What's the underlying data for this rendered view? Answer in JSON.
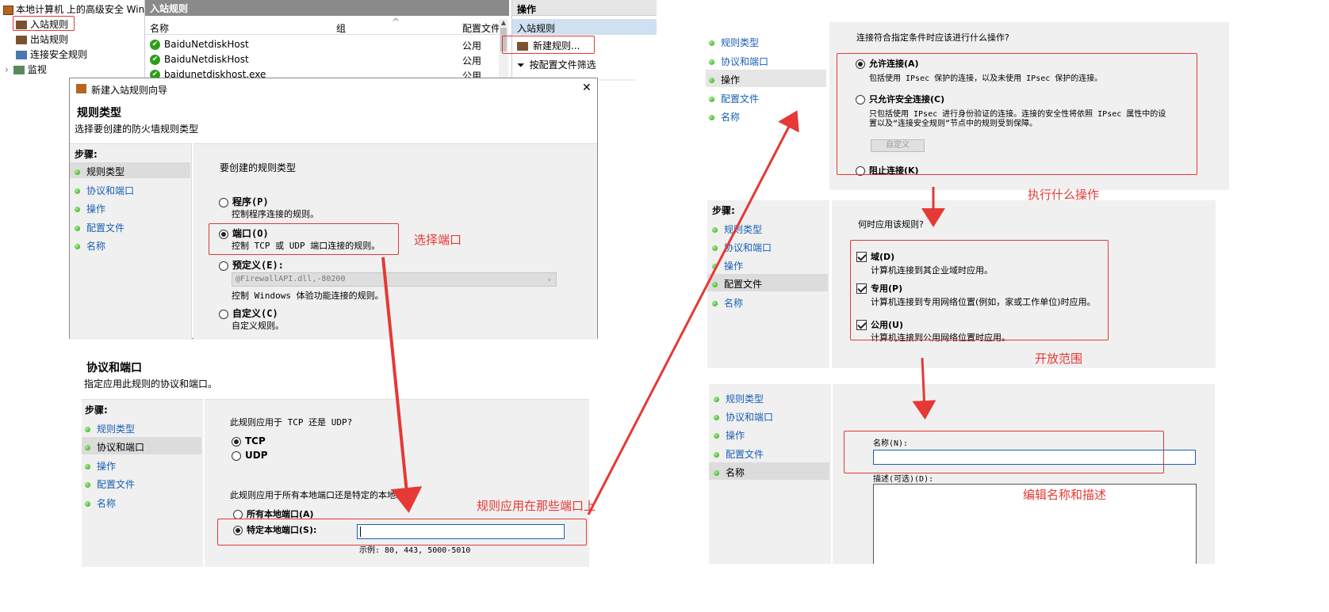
{
  "tree": {
    "root": "本地计算机 上的高级安全 Wind",
    "inbound": "入站规则",
    "outbound": "出站规则",
    "connsec": "连接安全规则",
    "monitor": "监视"
  },
  "list": {
    "header": "入站规则",
    "col_name": "名称",
    "col_group": "组",
    "col_profile": "配置文件",
    "rows": [
      {
        "name": "BaiduNetdiskHost",
        "profile": "公用"
      },
      {
        "name": "BaiduNetdiskHost",
        "profile": "公用"
      },
      {
        "name": "baidunetdiskhost.exe",
        "profile": "公用"
      }
    ]
  },
  "actions": {
    "header": "操作",
    "sub": "入站规则",
    "new_rule": "新建规则...",
    "filter": "按配置文件筛选"
  },
  "wizard": {
    "title": "新建入站规则向导",
    "close": "✕",
    "heading": "规则类型",
    "subheading": "选择要创建的防火墙规则类型",
    "steps_label": "步骤:",
    "steps": [
      "规则类型",
      "协议和端口",
      "操作",
      "配置文件",
      "名称"
    ],
    "prompt": "要创建的规则类型",
    "opt_program": "程序(P)",
    "opt_program_desc": "控制程序连接的规则。",
    "opt_port": "端口(O)",
    "opt_port_desc": "控制 TCP 或 UDP 端口连接的规则。",
    "opt_predef": "预定义(E):",
    "predef_value": "@FirewallAPI.dll,-80200",
    "opt_predef_desc": "控制 Windows 体验功能连接的规则。",
    "opt_custom": "自定义(C)",
    "opt_custom_desc": "自定义规则。"
  },
  "proto": {
    "heading": "协议和端口",
    "subheading": "指定应用此规则的协议和端口。",
    "steps_label": "步骤:",
    "steps": [
      "规则类型",
      "协议和端口",
      "操作",
      "配置文件",
      "名称"
    ],
    "q1": "此规则应用于 TCP 还是 UDP?",
    "tcp": "TCP",
    "udp": "UDP",
    "q2": "此规则应用于所有本地端口还是特定的本地端口?",
    "all_ports": "所有本地端口(A)",
    "specific_ports": "特定本地端口(S):",
    "example": "示例: 80, 443, 5000-5010"
  },
  "action_panel": {
    "steps": [
      "规则类型",
      "协议和端口",
      "操作",
      "配置文件",
      "名称"
    ],
    "q": "连接符合指定条件时应该进行什么操作?",
    "allow": "允许连接(A)",
    "allow_desc": "包括使用 IPsec 保护的连接，以及未使用 IPsec 保护的连接。",
    "allow_secure": "只允许安全连接(C)",
    "allow_secure_desc1": "只包括使用 IPsec 进行身份验证的连接。连接的安全性将依照 IPsec 属性中的设",
    "allow_secure_desc2": "置以及“连接安全规则”节点中的规则受到保障。",
    "customize": "自定义",
    "block": "阻止连接(K)"
  },
  "profile_panel": {
    "steps_label": "步骤:",
    "steps": [
      "规则类型",
      "协议和端口",
      "操作",
      "配置文件",
      "名称"
    ],
    "q": "何时应用该规则?",
    "domain": "域(D)",
    "domain_desc": "计算机连接到其企业域时应用。",
    "private": "专用(P)",
    "private_desc": "计算机连接到专用网络位置(例如，家或工作单位)时应用。",
    "public": "公用(U)",
    "public_desc": "计算机连接到公用网络位置时应用。"
  },
  "name_panel": {
    "steps": [
      "规则类型",
      "协议和端口",
      "操作",
      "配置文件",
      "名称"
    ],
    "name_label": "名称(N):",
    "desc_label": "描述(可选)(D):"
  },
  "annotations": {
    "select_port": "选择端口",
    "which_ports": "规则应用在那些端口上",
    "what_action": "执行什么操作",
    "open_scope": "开放范围",
    "edit_name": "编辑名称和描述"
  },
  "colors": {
    "annotation": "#e53935",
    "link": "#1a5fb4",
    "panel": "#f0f0f0"
  }
}
